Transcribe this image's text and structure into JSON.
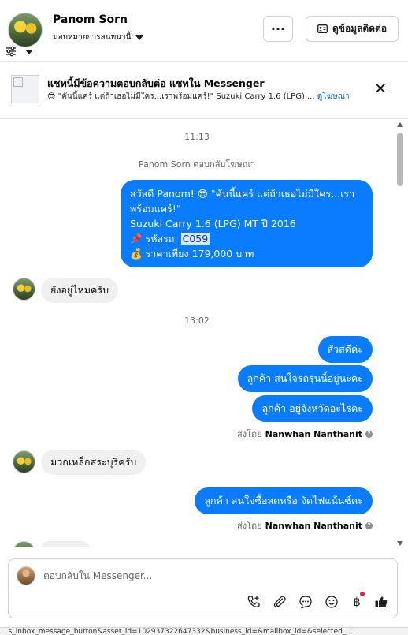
{
  "header": {
    "contact_name": "Panom Sorn",
    "assign_label": "มอบหมายการสนทนานี้",
    "more_label": "···",
    "contact_info_label": "ดูข้อมูลติดต่อ"
  },
  "banner": {
    "title": "แชทนี้มีข้อความตอบกลับต่อ แชทใน Messenger",
    "emoji": "😎",
    "subtitle": "\"คันนี้แคร์ แต่ถ้าเธอไม่มีใคร...เราพร้อมแคร์!\" Suzuki Carry 1.6 (LPG) ...",
    "link": "ดูโฆษณา"
  },
  "thread": {
    "time_1": "11:13",
    "reply_meta": "Panom Sorn ตอบกลับโฆษณา",
    "ad_message": {
      "line1": "สวัสดี Panom! 😎 \"คันนี้แคร์ แต่ถ้าเธอไม่มีใคร...เรา",
      "line2": "พร้อมแคร์!\"",
      "line3": "Suzuki Carry 1.6 (LPG) MT ปี 2016",
      "line4_prefix": "📌 รหัสรถ: ",
      "line4_code": "C059",
      "line5": "💰 ราคาเพียง 179,000 บาท"
    },
    "incoming_1": "ยังอยู่ไหมครับ",
    "time_2": "13:02",
    "outgoing_1": "สัวสดีค่ะ",
    "outgoing_2": "ลูกค้า สนใจรถรุ่นนี้อยู่นะคะ",
    "outgoing_3": "ลูกค้า อยู่จังหวัดอะไรคะ",
    "sent_by_prefix": "ส่งโดย",
    "sent_by_name": "Nanwhan Nanthanit",
    "incoming_2": "มวกเหล็กสระบุรีครับ",
    "outgoing_4": "ลูกค้า สนใจซื้อสดหรือ จัดไฟแน้นซ์คะ",
    "sent_by_prefix_2": "ส่งโดย",
    "sent_by_name_2": "Nanwhan Nanthanit"
  },
  "composer": {
    "placeholder": "ตอบกลับใน Messenger..."
  },
  "statusbar": {
    "url": "...s_inbox_message_button&asset_id=102937322647332&business_id=&mailbox_id=&selected_i..."
  },
  "colors": {
    "accent": "#0a7cff",
    "link": "#0a66c2",
    "incoming_bubble": "#f0f0f0"
  }
}
